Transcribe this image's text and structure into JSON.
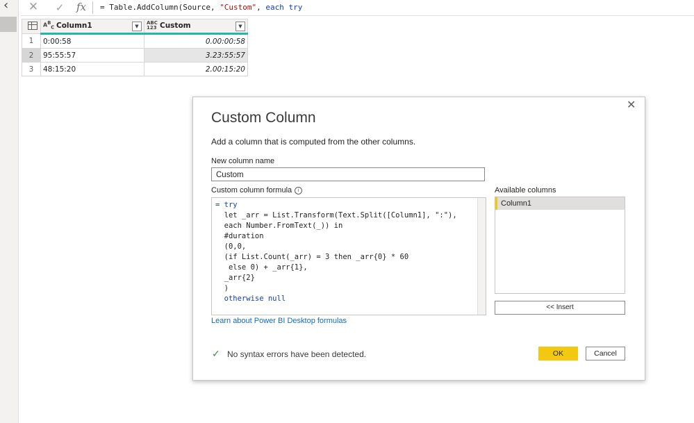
{
  "formula_bar": {
    "cancel_icon": "✕",
    "commit_icon": "✓",
    "fx_label": "fx",
    "expr_prefix": "= Table.AddColumn(Source, ",
    "expr_string": "\"Custom\"",
    "expr_mid": ", ",
    "expr_each": "each",
    "expr_space": " ",
    "expr_try": "try"
  },
  "table": {
    "type_badge_text": "Aᴮᶜ",
    "type_badge_any": "ABC\n123",
    "columns": [
      {
        "name": "Column1",
        "type_icon": "text-type-icon"
      },
      {
        "name": "Custom",
        "type_icon": "any-type-icon"
      }
    ],
    "rows": [
      {
        "n": "1",
        "col1": "0:00:58",
        "custom": "0.00:00:58"
      },
      {
        "n": "2",
        "col1": "95:55:57",
        "custom": "3.23:55:57"
      },
      {
        "n": "3",
        "col1": "48:15:20",
        "custom": "2.00:15:20"
      }
    ],
    "selected_row": 2
  },
  "dialog": {
    "title": "Custom Column",
    "subtitle": "Add a column that is computed from the other columns.",
    "new_column_label": "New column name",
    "new_column_value": "Custom",
    "formula_label": "Custom column formula",
    "available_label": "Available columns",
    "available_columns": [
      "Column1"
    ],
    "insert_label": "<< Insert",
    "learn_link": "Learn about Power BI Desktop formulas",
    "status_text": "No syntax errors have been detected.",
    "ok_label": "OK",
    "cancel_label": "Cancel",
    "formula_lines": [
      "= try",
      "  let _arr = List.Transform(Text.Split([Column1], \":\"),",
      "  each Number.FromText(_)) in",
      "  #duration",
      "  (0,0,",
      "  (if List.Count(_arr) = 3 then _arr{0} * 60",
      "   else 0) + _arr{1},",
      "  _arr{2}",
      "  )",
      "  otherwise null"
    ]
  },
  "colors": {
    "accent_yellow": "#f2c811",
    "header_underline": "#1fb9a6",
    "link_blue": "#0f6cbd",
    "success_green": "#3a8c4a"
  }
}
